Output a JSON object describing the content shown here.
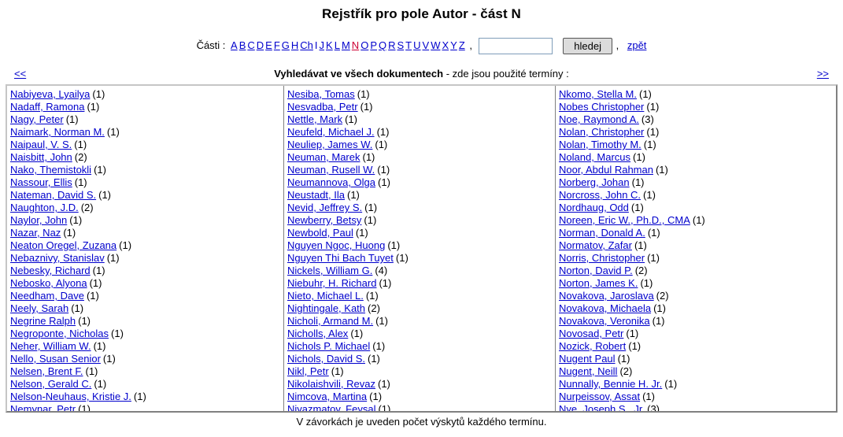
{
  "page": {
    "title": "Rejstřík pro pole Autor - část N",
    "footer_note": "V závorkách je uveden počet výskytů každého termínu."
  },
  "colors": {
    "link": "#0000cc",
    "current_letter": "#cc0033",
    "border": "#808080"
  },
  "parts_bar": {
    "label": "Části :",
    "letters": [
      {
        "label": "A",
        "state": "link"
      },
      {
        "label": "B",
        "state": "link"
      },
      {
        "label": "C",
        "state": "link"
      },
      {
        "label": "D",
        "state": "link"
      },
      {
        "label": "E",
        "state": "link"
      },
      {
        "label": "F",
        "state": "link"
      },
      {
        "label": "G",
        "state": "link"
      },
      {
        "label": "H",
        "state": "link"
      },
      {
        "label": "Ch",
        "state": "link"
      },
      {
        "label": "I",
        "state": "plain"
      },
      {
        "label": "J",
        "state": "link"
      },
      {
        "label": "K",
        "state": "link"
      },
      {
        "label": "L",
        "state": "link"
      },
      {
        "label": "M",
        "state": "link"
      },
      {
        "label": "N",
        "state": "current"
      },
      {
        "label": "O",
        "state": "link"
      },
      {
        "label": "P",
        "state": "link"
      },
      {
        "label": "Q",
        "state": "link"
      },
      {
        "label": "R",
        "state": "link"
      },
      {
        "label": "S",
        "state": "link"
      },
      {
        "label": "T",
        "state": "link"
      },
      {
        "label": "U",
        "state": "link"
      },
      {
        "label": "V",
        "state": "link"
      },
      {
        "label": "W",
        "state": "link"
      },
      {
        "label": "X",
        "state": "link"
      },
      {
        "label": "Y",
        "state": "link"
      },
      {
        "label": "Z",
        "state": "link"
      }
    ],
    "separator": ",",
    "search_value": "",
    "search_placeholder": "",
    "search_button": "hledej",
    "after_button_separator": ",",
    "back_link": "zpět"
  },
  "pager": {
    "prev": "<<",
    "next": ">>",
    "all_docs_link": "Vyhledávat ve všech dokumentech",
    "all_docs_suffix": " - zde jsou použité termíny :"
  },
  "columns": [
    {
      "terms": [
        {
          "name": "Nabiyeva, Lyailya",
          "count": "(1)"
        },
        {
          "name": "Nadaff, Ramona",
          "count": "(1)"
        },
        {
          "name": "Nagy, Peter",
          "count": "(1)"
        },
        {
          "name": "Naimark, Norman M.",
          "count": "(1)"
        },
        {
          "name": "Naipaul, V. S.",
          "count": "(1)"
        },
        {
          "name": "Naisbitt, John",
          "count": "(2)"
        },
        {
          "name": "Nako, Themistokli",
          "count": "(1)"
        },
        {
          "name": "Nassour, Ellis",
          "count": "(1)"
        },
        {
          "name": "Nateman, David S.",
          "count": "(1)"
        },
        {
          "name": "Naughton, J.D.",
          "count": "(2)"
        },
        {
          "name": "Naylor, John",
          "count": "(1)"
        },
        {
          "name": "Nazar, Naz",
          "count": "(1)"
        },
        {
          "name": "Neaton Oregel, Zuzana",
          "count": "(1)"
        },
        {
          "name": "Nebaznivy, Stanislav",
          "count": "(1)"
        },
        {
          "name": "Nebesky, Richard",
          "count": "(1)"
        },
        {
          "name": "Nebosko, Alyona",
          "count": "(1)"
        },
        {
          "name": "Needham, Dave",
          "count": "(1)"
        },
        {
          "name": "Neely, Sarah",
          "count": "(1)"
        },
        {
          "name": "Negrine Ralph",
          "count": "(1)"
        },
        {
          "name": "Negroponte, Nicholas",
          "count": "(1)"
        },
        {
          "name": "Neher, William W.",
          "count": "(1)"
        },
        {
          "name": "Nello, Susan Senior",
          "count": "(1)"
        },
        {
          "name": "Nelsen, Brent F.",
          "count": "(1)"
        },
        {
          "name": "Nelson, Gerald C.",
          "count": "(1)"
        },
        {
          "name": "Nelson-Neuhaus, Kristie J.",
          "count": "(1)"
        },
        {
          "name": "Nemynar, Petr",
          "count": "(1)"
        }
      ]
    },
    {
      "terms": [
        {
          "name": "Nesiba, Tomas",
          "count": "(1)"
        },
        {
          "name": "Nesvadba, Petr",
          "count": "(1)"
        },
        {
          "name": "Nettle, Mark",
          "count": "(1)"
        },
        {
          "name": "Neufeld, Michael J.",
          "count": "(1)"
        },
        {
          "name": "Neuliep, James W.",
          "count": "(1)"
        },
        {
          "name": "Neuman, Marek",
          "count": "(1)"
        },
        {
          "name": "Neuman, Rusell W.",
          "count": "(1)"
        },
        {
          "name": "Neumannova, Olga",
          "count": "(1)"
        },
        {
          "name": "Neustadt, Ila",
          "count": "(1)"
        },
        {
          "name": "Nevid, Jeffrey S.",
          "count": "(1)"
        },
        {
          "name": "Newberry, Betsy",
          "count": "(1)"
        },
        {
          "name": "Newbold, Paul",
          "count": "(1)"
        },
        {
          "name": "Nguyen Ngoc, Huong",
          "count": "(1)"
        },
        {
          "name": "Nguyen Thi Bach Tuyet",
          "count": "(1)"
        },
        {
          "name": "Nickels, William G.",
          "count": "(4)"
        },
        {
          "name": "Niebuhr, H. Richard",
          "count": "(1)"
        },
        {
          "name": "Nieto, Michael L.",
          "count": "(1)"
        },
        {
          "name": "Nightingale, Kath",
          "count": "(2)"
        },
        {
          "name": "Nicholi, Armand M.",
          "count": "(1)"
        },
        {
          "name": "Nicholls, Alex",
          "count": "(1)"
        },
        {
          "name": "Nichols P. Michael",
          "count": "(1)"
        },
        {
          "name": "Nichols, David S.",
          "count": "(1)"
        },
        {
          "name": "Nikl, Petr",
          "count": "(1)"
        },
        {
          "name": "Nikolaishvili, Revaz",
          "count": "(1)"
        },
        {
          "name": "Nimcova, Martina",
          "count": "(1)"
        },
        {
          "name": "Niyazmatov, Feysal",
          "count": "(1)"
        }
      ]
    },
    {
      "terms": [
        {
          "name": "Nkomo, Stella M.",
          "count": "(1)"
        },
        {
          "name": "Nobes Christopher",
          "count": "(1)"
        },
        {
          "name": "Noe, Raymond A.",
          "count": "(3)"
        },
        {
          "name": "Nolan, Christopher",
          "count": "(1)"
        },
        {
          "name": "Nolan, Timothy M.",
          "count": "(1)"
        },
        {
          "name": "Noland, Marcus",
          "count": "(1)"
        },
        {
          "name": "Noor, Abdul Rahman",
          "count": "(1)"
        },
        {
          "name": "Norberg, Johan",
          "count": "(1)"
        },
        {
          "name": "Norcross, John C.",
          "count": "(1)"
        },
        {
          "name": "Nordhaug, Odd",
          "count": "(1)"
        },
        {
          "name": "Noreen, Eric W., Ph.D., CMA",
          "count": "(1)"
        },
        {
          "name": "Norman, Donald A.",
          "count": "(1)"
        },
        {
          "name": "Normatov, Zafar",
          "count": "(1)"
        },
        {
          "name": "Norris, Christopher",
          "count": "(1)"
        },
        {
          "name": "Norton, David P.",
          "count": "(2)"
        },
        {
          "name": "Norton, James K.",
          "count": "(1)"
        },
        {
          "name": "Novakova, Jaroslava",
          "count": "(2)"
        },
        {
          "name": "Novakova, Michaela",
          "count": "(1)"
        },
        {
          "name": "Novakova, Veronika",
          "count": "(1)"
        },
        {
          "name": "Novosad, Petr",
          "count": "(1)"
        },
        {
          "name": "Nozick, Robert",
          "count": "(1)"
        },
        {
          "name": "Nugent Paul",
          "count": "(1)"
        },
        {
          "name": "Nugent, Neill",
          "count": "(2)"
        },
        {
          "name": "Nunnally, Bennie H. Jr.",
          "count": "(1)"
        },
        {
          "name": "Nurpeissov, Assat",
          "count": "(1)"
        },
        {
          "name": "Nye, Joseph S., Jr.",
          "count": "(3)"
        }
      ]
    }
  ]
}
